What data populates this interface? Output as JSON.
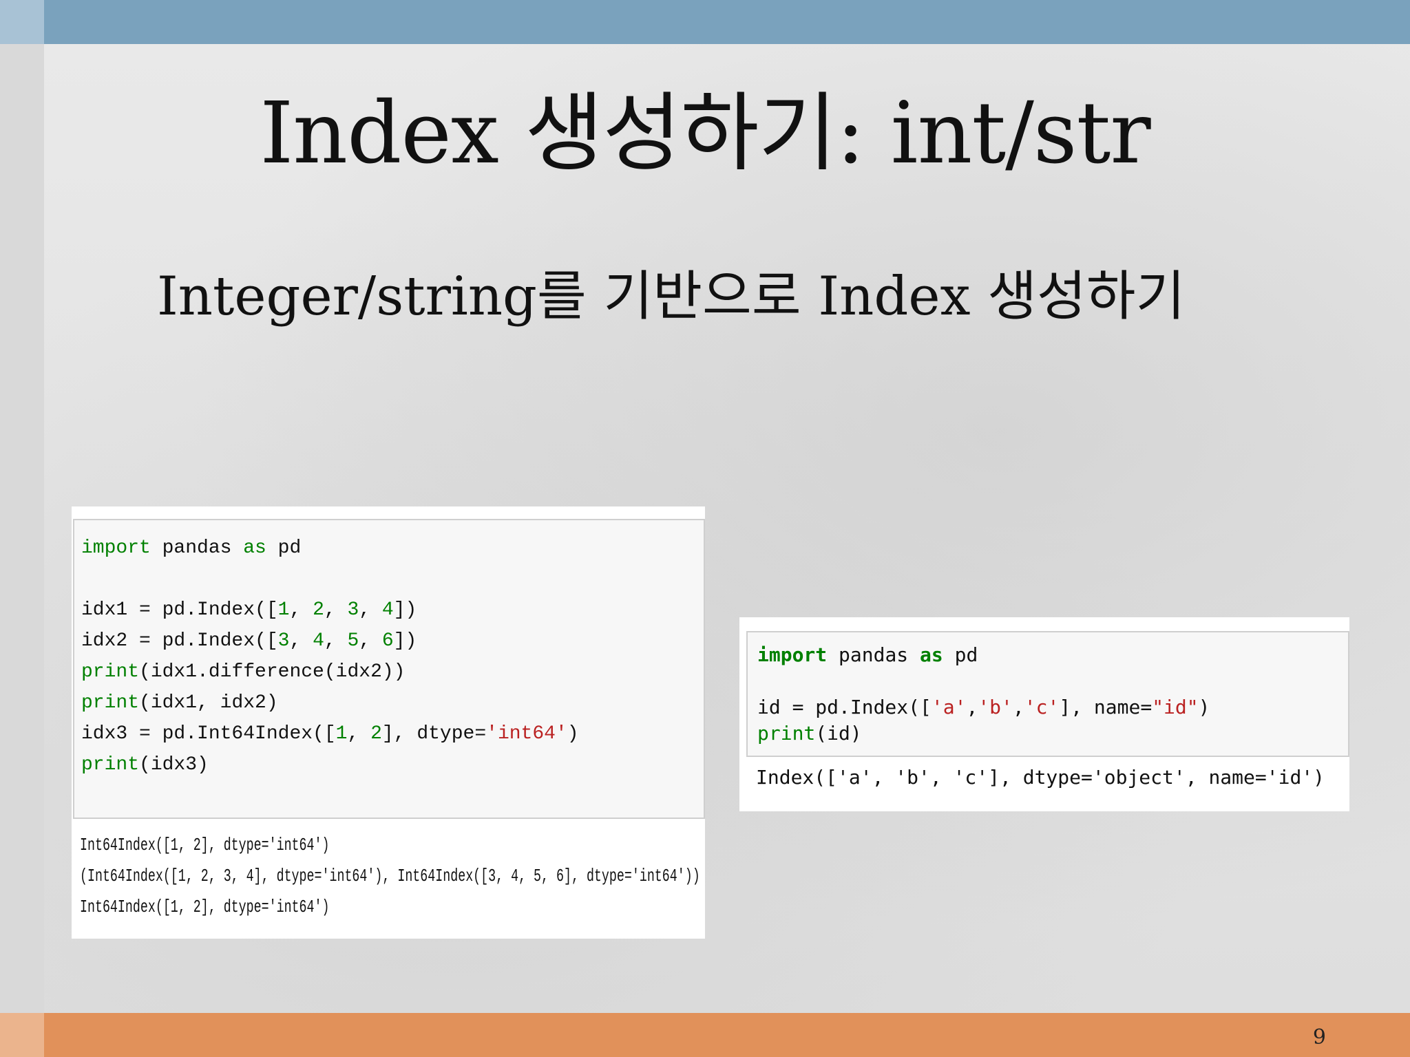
{
  "slide": {
    "title": "Index 생성하기: int/str",
    "subtitle": "Integer/string를 기반으로 Index 생성하기",
    "page_number": "9"
  },
  "left_code": {
    "input_lines": [
      [
        {
          "t": "import",
          "c": "kw-light"
        },
        {
          "t": " pandas ",
          "c": "plain"
        },
        {
          "t": "as",
          "c": "kw-light"
        },
        {
          "t": " pd",
          "c": "plain"
        }
      ],
      [],
      [
        {
          "t": "idx1 = pd.Index([",
          "c": "plain"
        },
        {
          "t": "1",
          "c": "num"
        },
        {
          "t": ", ",
          "c": "plain"
        },
        {
          "t": "2",
          "c": "num"
        },
        {
          "t": ", ",
          "c": "plain"
        },
        {
          "t": "3",
          "c": "num"
        },
        {
          "t": ", ",
          "c": "plain"
        },
        {
          "t": "4",
          "c": "num"
        },
        {
          "t": "])",
          "c": "plain"
        }
      ],
      [
        {
          "t": "idx2 = pd.Index([",
          "c": "plain"
        },
        {
          "t": "3",
          "c": "num"
        },
        {
          "t": ", ",
          "c": "plain"
        },
        {
          "t": "4",
          "c": "num"
        },
        {
          "t": ", ",
          "c": "plain"
        },
        {
          "t": "5",
          "c": "num"
        },
        {
          "t": ", ",
          "c": "plain"
        },
        {
          "t": "6",
          "c": "num"
        },
        {
          "t": "])",
          "c": "plain"
        }
      ],
      [
        {
          "t": "print",
          "c": "kw-light"
        },
        {
          "t": "(idx1.difference(idx2))",
          "c": "plain"
        }
      ],
      [
        {
          "t": "print",
          "c": "kw-light"
        },
        {
          "t": "(idx1, idx2)",
          "c": "plain"
        }
      ],
      [
        {
          "t": "idx3 = pd.Int64Index([",
          "c": "plain"
        },
        {
          "t": "1",
          "c": "num"
        },
        {
          "t": ", ",
          "c": "plain"
        },
        {
          "t": "2",
          "c": "num"
        },
        {
          "t": "], dtype=",
          "c": "plain"
        },
        {
          "t": "'int64'",
          "c": "str"
        },
        {
          "t": ")",
          "c": "plain"
        }
      ],
      [
        {
          "t": "print",
          "c": "kw-light"
        },
        {
          "t": "(idx3)",
          "c": "plain"
        }
      ]
    ],
    "output_lines": [
      "Int64Index([1, 2], dtype='int64')",
      "(Int64Index([1, 2, 3, 4], dtype='int64'), Int64Index([3, 4, 5, 6], dtype='int64'))",
      "Int64Index([1, 2], dtype='int64')"
    ]
  },
  "right_code": {
    "input_lines": [
      [
        {
          "t": "import",
          "c": "kw"
        },
        {
          "t": " pandas ",
          "c": "plain"
        },
        {
          "t": "as",
          "c": "kw"
        },
        {
          "t": " pd",
          "c": "plain"
        }
      ],
      [],
      [
        {
          "t": "id = pd.Index([",
          "c": "plain"
        },
        {
          "t": "'a'",
          "c": "str"
        },
        {
          "t": ",",
          "c": "plain"
        },
        {
          "t": "'b'",
          "c": "str"
        },
        {
          "t": ",",
          "c": "plain"
        },
        {
          "t": "'c'",
          "c": "str"
        },
        {
          "t": "], name=",
          "c": "plain"
        },
        {
          "t": "\"id\"",
          "c": "str"
        },
        {
          "t": ")",
          "c": "plain"
        }
      ],
      [
        {
          "t": "print",
          "c": "kw-light"
        },
        {
          "t": "(id)",
          "c": "plain"
        }
      ]
    ],
    "output_lines": [
      "Index(['a', 'b', 'c'], dtype='object', name='id')"
    ]
  },
  "colors": {
    "top_bar": "#7aa2bd",
    "bottom_bar": "#e1915a",
    "keyword": "#008000",
    "string": "#ba2121"
  }
}
